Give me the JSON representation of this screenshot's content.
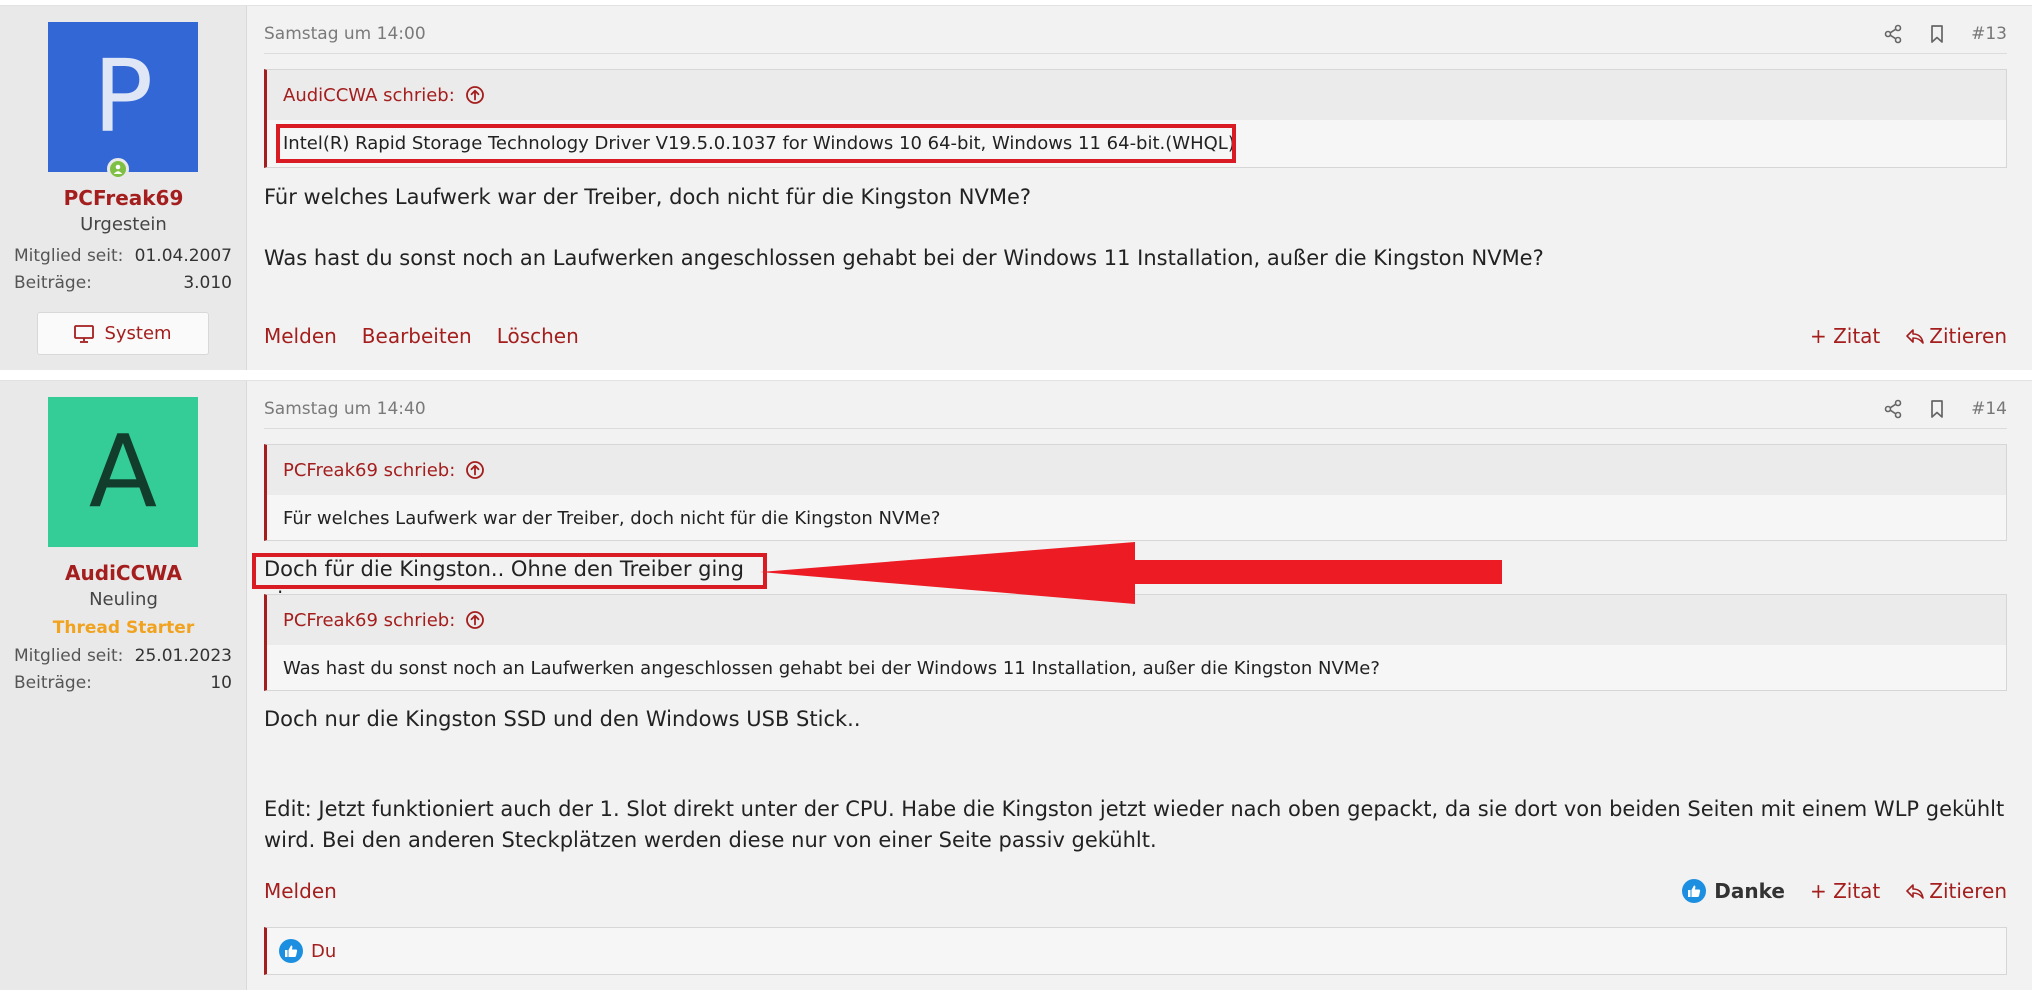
{
  "posts": [
    {
      "user": {
        "avatar_letter": "P",
        "name": "PCFreak69",
        "title": "Urgestein",
        "joined_label": "Mitglied seit:",
        "joined_value": "01.04.2007",
        "posts_label": "Beiträge:",
        "posts_value": "3.010",
        "system_label": "System"
      },
      "date": "Samstag um 14:00",
      "number": "#13",
      "quote": {
        "author": "AudiCCWA schrieb:",
        "text": "Intel(R) Rapid Storage Technology Driver V19.5.0.1037 for Windows 10 64-bit, Windows 11 64-bit.(WHQL)"
      },
      "body": [
        "Für welches Laufwerk war der Treiber, doch nicht für die Kingston NVMe?",
        "Was hast du sonst noch an Laufwerken angeschlossen gehabt bei der Windows 11 Installation, außer die Kingston NVMe?"
      ],
      "actions_left": [
        "Melden",
        "Bearbeiten",
        "Löschen"
      ],
      "actions_right": {
        "zitat": "+ Zitat",
        "zitieren": "Zitieren"
      }
    },
    {
      "user": {
        "avatar_letter": "A",
        "name": "AudiCCWA",
        "title": "Neuling",
        "badge": "Thread Starter",
        "joined_label": "Mitglied seit:",
        "joined_value": "25.01.2023",
        "posts_label": "Beiträge:",
        "posts_value": "10"
      },
      "date": "Samstag um 14:40",
      "number": "#14",
      "quote1": {
        "author": "PCFreak69 schrieb:",
        "text": "Für welches Laufwerk war der Treiber, doch nicht für die Kingston NVMe?"
      },
      "reply1": "Doch für die Kingston.. Ohne den Treiber ging nix.",
      "quote2": {
        "author": "PCFreak69 schrieb:",
        "text": "Was hast du sonst noch an Laufwerken angeschlossen gehabt bei der Windows 11 Installation, außer die Kingston NVMe?"
      },
      "reply2": "Doch nur die Kingston SSD und den Windows USB Stick..",
      "edit": "Edit: Jetzt funktioniert auch der 1. Slot direkt unter der CPU. Habe die Kingston jetzt wieder nach oben gepackt, da sie dort von beiden Seiten mit einem WLP gekühlt wird. Bei den anderen Steckplätzen werden diese nur von einer Seite passiv gekühlt.",
      "actions_left": [
        "Melden"
      ],
      "actions_right": {
        "danke": "Danke",
        "zitat": "+ Zitat",
        "zitieren": "Zitieren"
      },
      "reactions": "Du"
    }
  ],
  "colors": {
    "accent": "#a41e1e",
    "highlight": "#d91c24",
    "starter": "#f1a21f",
    "like": "#1d8fe1"
  }
}
